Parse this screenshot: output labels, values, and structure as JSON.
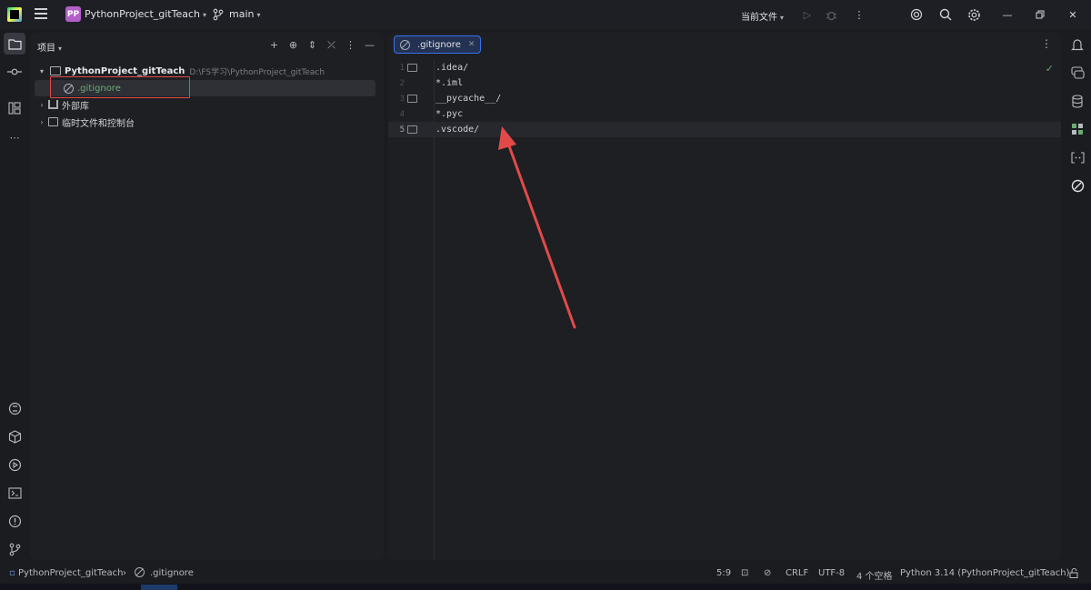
{
  "titlebar": {
    "project_badge": "PP",
    "project_name": "PythonProject_gitTeach",
    "branch": "main",
    "run_config": "当前文件"
  },
  "project_panel": {
    "title": "项目",
    "root": {
      "name": "PythonProject_gitTeach",
      "path": "D:\\FS学习\\PythonProject_gitTeach"
    },
    "selected_file": ".gitignore",
    "items": [
      {
        "label": "外部库"
      },
      {
        "label": "临时文件和控制台"
      }
    ]
  },
  "editor": {
    "tab_label": ".gitignore",
    "lines": [
      {
        "num": "1",
        "text": ".idea/"
      },
      {
        "num": "2",
        "text": "*.iml"
      },
      {
        "num": "3",
        "text": "__pycache__/"
      },
      {
        "num": "4",
        "text": "*.pyc"
      },
      {
        "num": "5",
        "text": ".vscode/"
      }
    ],
    "current_line": 5
  },
  "statusbar": {
    "breadcrumb_project": "PythonProject_gitTeach",
    "breadcrumb_file": ".gitignore",
    "position": "5:9",
    "line_separator": "CRLF",
    "encoding": "UTF-8",
    "indent": "4 个空格",
    "interpreter": "Python 3.14 (PythonProject_gitTeach)"
  },
  "colors": {
    "accent": "#3574f0",
    "highlight_box": "#e24a4a",
    "arrow": "#e24a4a",
    "project_badge": "#b35fc8"
  }
}
